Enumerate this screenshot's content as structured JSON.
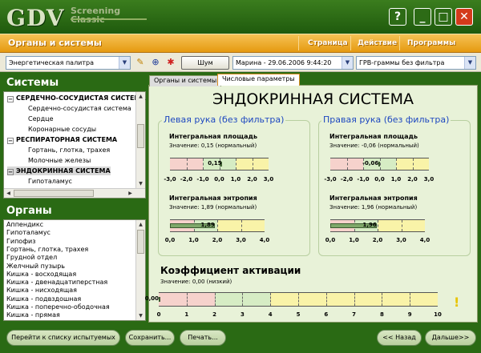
{
  "app": {
    "logo_text": "GDV",
    "logo_sub1": "Screening",
    "logo_sub2": "Classic",
    "help_icon": "?",
    "minimize_icon": "_",
    "maximize_icon": "□",
    "close_icon": "✕"
  },
  "menubar": {
    "title": "Органы и системы",
    "items": [
      "Страница",
      "Действие",
      "Программы"
    ]
  },
  "toolbar": {
    "palette": "Энергетическая палитра",
    "noise_button": "Шум",
    "subject": "Марина - 29.06.2006 9:44:20",
    "filter": "ГРВ-граммы без фильтра",
    "dropdown_arrow": "▼"
  },
  "systems": {
    "heading": "Системы",
    "rows": [
      {
        "text": "СЕРДЕЧНО-СОСУДИСТАЯ СИСТЕМА",
        "bold": true,
        "toggle": "−",
        "indent": 0
      },
      {
        "text": "Сердечно-сосудистая система",
        "bold": false,
        "toggle": "",
        "indent": 1
      },
      {
        "text": "Сердце",
        "bold": false,
        "toggle": "",
        "indent": 1
      },
      {
        "text": "Коронарные сосуды",
        "bold": false,
        "toggle": "",
        "indent": 1
      },
      {
        "text": "РЕСПИРАТОРНАЯ СИСТЕМА",
        "bold": true,
        "toggle": "−",
        "indent": 0
      },
      {
        "text": "Гортань, глотка, трахея",
        "bold": false,
        "toggle": "",
        "indent": 1
      },
      {
        "text": "Молочные железы",
        "bold": false,
        "toggle": "",
        "indent": 1
      },
      {
        "text": "ЭНДОКРИННАЯ СИСТЕМА",
        "bold": true,
        "toggle": "−",
        "indent": 0,
        "selected": true
      },
      {
        "text": "Гипоталамус",
        "bold": false,
        "toggle": "",
        "indent": 1
      }
    ]
  },
  "organs": {
    "heading": "Органы",
    "rows": [
      "Аппендикс",
      "Гипоталамус",
      "Гипофиз",
      "Гортань, глотка, трахея",
      "Грудной отдел",
      "Желчный пузырь",
      "Кишка - восходящая",
      "Кишка - двенадцатиперстная",
      "Кишка - нисходящая",
      "Кишка - подвздошная",
      "Кишка - поперечно-ободочная",
      "Кишка - прямая"
    ]
  },
  "tabs": [
    "Органы и системы",
    "Числовые параметры"
  ],
  "main": {
    "title": "ЭНДОКРИННАЯ СИСТЕМА",
    "left": {
      "heading": "Левая рука (без фильтра)",
      "area_label": "Интегральная площадь",
      "area_value_text": "Значение: 0,15 (нормальный)",
      "area_value": 0.15,
      "area_display": "0,15",
      "entropy_label": "Интегральная энтропия",
      "entropy_value_text": "Значение: 1,89 (нормальный)",
      "entropy_value": 1.89,
      "entropy_display": "1,89"
    },
    "right": {
      "heading": "Правая рука (без фильтра)",
      "area_label": "Интегральная площадь",
      "area_value_text": "Значение: -0,06 (нормальный)",
      "area_value": -0.06,
      "area_display": "-0,06",
      "entropy_label": "Интегральная энтропия",
      "entropy_value_text": "Значение: 1,96 (нормальный)",
      "entropy_value": 1.96,
      "entropy_display": "1,96"
    },
    "area_ticks": [
      "-3,0",
      "-2,0",
      "-1,0",
      "0,0",
      "1,0",
      "2,0",
      "3,0"
    ],
    "entropy_ticks": [
      "0,0",
      "1,0",
      "2,0",
      "3,0",
      "4,0"
    ],
    "activation": {
      "label": "Коэффициент активации",
      "value_text": "Значение: 0,00 (низкий)",
      "value": 0.0,
      "display": "0,00",
      "ticks": [
        "0",
        "1",
        "2",
        "3",
        "4",
        "5",
        "6",
        "7",
        "8",
        "9",
        "10"
      ],
      "alert_icon": "!"
    }
  },
  "bottom": {
    "to_list": "Перейти к списку испытуемых",
    "save": "Сохранить...",
    "print": "Печать...",
    "back": "<< Назад",
    "next": "Дальше>>"
  },
  "colors": {
    "accent_green": "#2a6a14",
    "menubar_orange": "#e59a10",
    "panel_green": "#e8f2d8",
    "gauge_red": "#f6d2cc",
    "gauge_green": "#d6ecc4",
    "gauge_yellow": "#f9f3a8",
    "hand_title_blue": "#1e48c0"
  }
}
